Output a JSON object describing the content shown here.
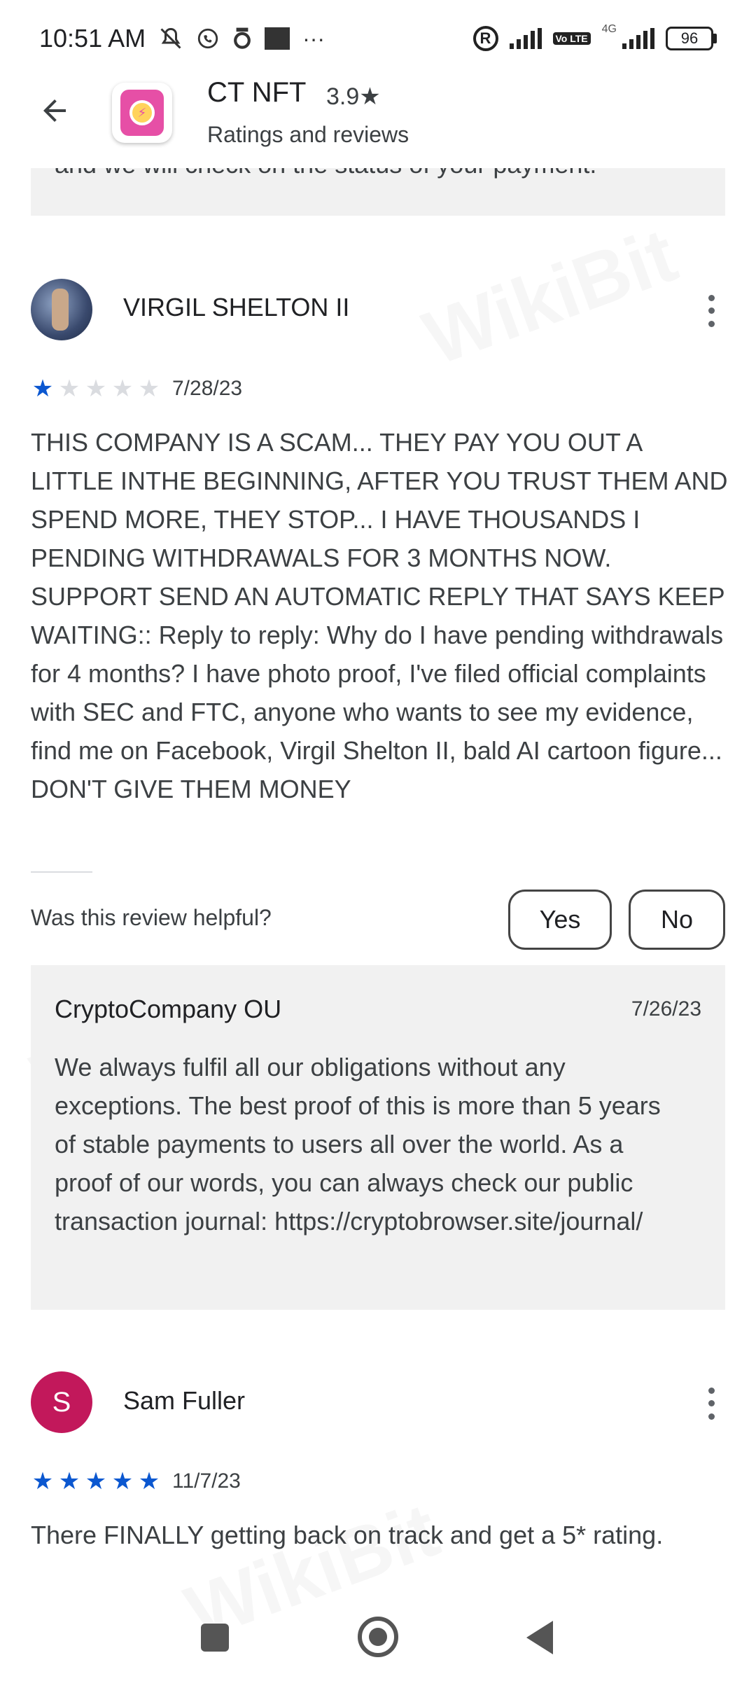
{
  "status_bar": {
    "time": "10:51 AM",
    "left_icons": [
      "muted-bell-icon",
      "whatsapp-icon",
      "app-icon",
      "square-icon",
      "more-icon"
    ],
    "dots": "···",
    "volte": "Vo LTE",
    "network": "4G",
    "battery": "96"
  },
  "header": {
    "title": "CT NFT",
    "rating": "3.9★",
    "subtitle": "Ratings and reviews"
  },
  "previous_reply": {
    "text": "and we will check on the status of your payment."
  },
  "reviews": [
    {
      "name": "VIRGIL SHELTON II",
      "stars": 1,
      "date": "7/28/23",
      "text": "THIS COMPANY IS A SCAM... THEY PAY YOU OUT A LITTLE INTHE BEGINNING, AFTER YOU TRUST THEM AND SPEND MORE, THEY STOP... I HAVE THOUSANDS I PENDING WITHDRAWALS FOR 3 MONTHS NOW. SUPPORT SEND AN AUTOMATIC REPLY THAT SAYS KEEP WAITING:: Reply to reply: Why do I have pending withdrawals for 4 months? I have photo proof, I've filed official complaints with SEC and FTC, anyone who wants to see my evidence, find me on Facebook, Virgil Shelton II, bald AI cartoon figure... DON'T GIVE THEM MONEY",
      "helpful_label": "Was this review helpful?",
      "yes_label": "Yes",
      "no_label": "No",
      "developer_reply": {
        "name": "CryptoCompany OU",
        "date": "7/26/23",
        "text": "We always fulfil all our obligations without any exceptions. The best proof of this is more than 5 years of stable payments to users all over the world. As a proof of our words, you can always check our public transaction journal: https://cryptobrowser.site/journal/"
      }
    },
    {
      "name": "Sam Fuller",
      "avatar_letter": "S",
      "avatar_color": "#c2185b",
      "stars": 5,
      "date": "11/7/23",
      "text": "There FINALLY getting back on track and get a 5* rating."
    }
  ],
  "colors": {
    "star_on": "#0b57d0",
    "star_off": "#dadce0",
    "reply_bg": "#f1f1f1"
  }
}
